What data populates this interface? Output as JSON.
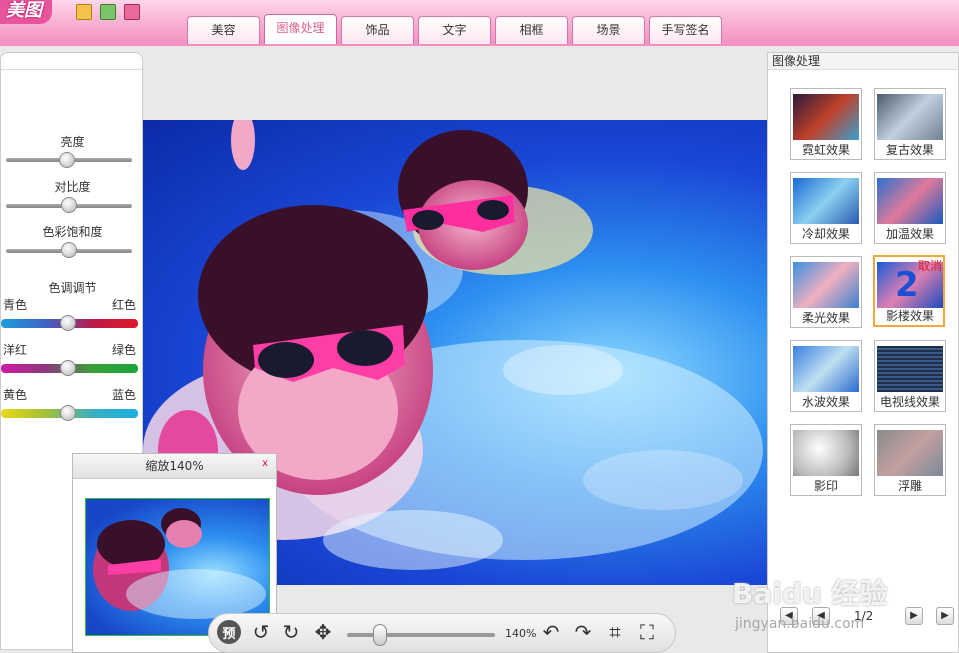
{
  "app": {
    "logo": "美图"
  },
  "tabs": [
    "美容",
    "图像处理",
    "饰品",
    "文字",
    "相框",
    "场景",
    "手写签名"
  ],
  "active_tab": "图像处理",
  "left_panel": {
    "sliders": [
      {
        "label": "亮度",
        "level": 0.5
      },
      {
        "label": "对比度",
        "level": 0.5
      },
      {
        "label": "色彩饱和度",
        "level": 0.5
      }
    ],
    "tone_title": "色调调节",
    "tone_bars": [
      {
        "left": "青色",
        "right": "红色",
        "level": 0.5
      },
      {
        "left": "洋红",
        "right": "绿色",
        "level": 0.5
      },
      {
        "left": "黄色",
        "right": "蓝色",
        "level": 0.5
      }
    ]
  },
  "zoom_window": {
    "title": "缩放140%",
    "close": "x"
  },
  "bottom_toolbar": {
    "preview": "预",
    "zoom_label": "140%"
  },
  "right_panel": {
    "title": "图像处理",
    "effects": [
      {
        "label": "霓虹效果"
      },
      {
        "label": "复古效果"
      },
      {
        "label": "冷却效果"
      },
      {
        "label": "加温效果"
      },
      {
        "label": "柔光效果"
      },
      {
        "label": "影楼效果",
        "selected": true,
        "badge": "2",
        "cancel": "取消"
      },
      {
        "label": "水波效果"
      },
      {
        "label": "电视线效果"
      },
      {
        "label": "影印"
      },
      {
        "label": "浮雕"
      }
    ],
    "pager": {
      "label": "1/2"
    }
  },
  "watermark": {
    "line1": "Baidu 经验",
    "line2": "jingyan.baidu.com"
  }
}
